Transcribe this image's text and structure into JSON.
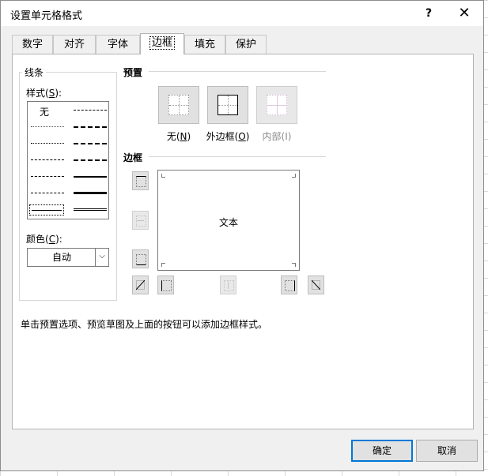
{
  "window": {
    "title": "设置单元格格式",
    "help": "?",
    "close": "✕"
  },
  "tabs": [
    {
      "label": "数字"
    },
    {
      "label": "对齐"
    },
    {
      "label": "字体"
    },
    {
      "label": "边框"
    },
    {
      "label": "填充"
    },
    {
      "label": "保护"
    }
  ],
  "active_tab": "边框",
  "line": {
    "group_label": "线条",
    "style_label": "样式(",
    "style_key": "S",
    "style_suffix": "):",
    "none_label": "无",
    "color_label": "颜色(",
    "color_key": "C",
    "color_suffix": "):",
    "color_value": "自动",
    "dropdown_icon": "chevron-down-icon"
  },
  "presets": {
    "section_label": "预置",
    "items": [
      {
        "label": "无",
        "key": "N",
        "enabled": true
      },
      {
        "label": "外边框",
        "key": "O",
        "enabled": true
      },
      {
        "label": "内部",
        "key": "I",
        "enabled": false
      }
    ]
  },
  "border": {
    "section_label": "边框",
    "preview_text": "文本"
  },
  "hint": "单击预置选项、预览草图及上面的按钮可以添加边框样式。",
  "buttons": {
    "ok": "确定",
    "cancel": "取消"
  }
}
